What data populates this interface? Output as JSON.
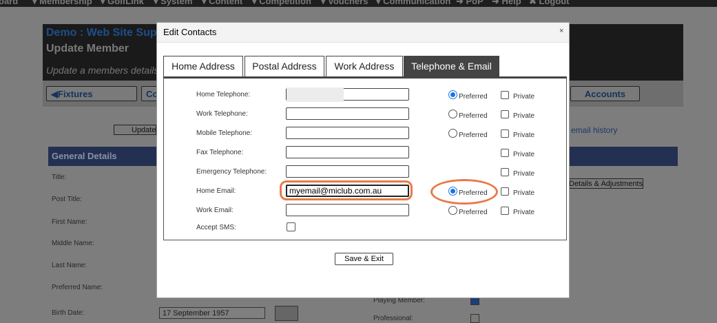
{
  "topnav": [
    "oard",
    "Membership",
    "GolfLink",
    "System",
    "Content",
    "Competition",
    "Vouchers",
    "Communication",
    "PoP",
    "Help",
    "Logout"
  ],
  "header": {
    "title": "Demo : Web Site Sup",
    "subtitle": "Update Member",
    "desc": "Update a members details"
  },
  "buttons": {
    "fixtures": "◀Fixtures",
    "co": "Co",
    "accounts": "Accounts",
    "update": "Update",
    "email_history": "email history",
    "details": "Details & Adjustments"
  },
  "section": {
    "title": "General Details"
  },
  "bg_labels": {
    "title": "Title:",
    "post_title": "Post Title:",
    "first_name": "First Name:",
    "middle_name": "Middle Name:",
    "last_name": "Last Name:",
    "preferred_name": "Preferred Name:",
    "birth_date": "Birth Date:",
    "playing_member": "Playing Member:",
    "professional": "Professional:"
  },
  "birth_date_value": "17 September 1957",
  "modal": {
    "title": "Edit Contacts",
    "close": "×",
    "tabs": [
      {
        "label": "Home Address",
        "active": false
      },
      {
        "label": "Postal Address",
        "active": false
      },
      {
        "label": "Work Address",
        "active": false
      },
      {
        "label": "Telephone & Email",
        "active": true
      }
    ],
    "fields": [
      {
        "label": "Home Telephone:",
        "value": "",
        "preferred": true,
        "show_preferred": true
      },
      {
        "label": "Work Telephone:",
        "value": "",
        "preferred": false,
        "show_preferred": true
      },
      {
        "label": "Mobile Telephone:",
        "value": "",
        "preferred": false,
        "show_preferred": true
      },
      {
        "label": "Fax Telephone:",
        "value": "",
        "preferred": false,
        "show_preferred": false
      },
      {
        "label": "Emergency Telephone:",
        "value": "",
        "preferred": false,
        "show_preferred": false
      },
      {
        "label": "Home Email:",
        "value": "myemail@miclub.com.au",
        "preferred": true,
        "show_preferred": true
      },
      {
        "label": "Work Email:",
        "value": "",
        "preferred": false,
        "show_preferred": true
      }
    ],
    "preferred_label": "Preferred",
    "private_label": "Private",
    "accept_sms_label": "Accept SMS:",
    "save_label": "Save & Exit"
  },
  "colors": {
    "highlight": "#e87a4a",
    "radio_selected": "#1a73e8",
    "tab_active": "#444444"
  }
}
